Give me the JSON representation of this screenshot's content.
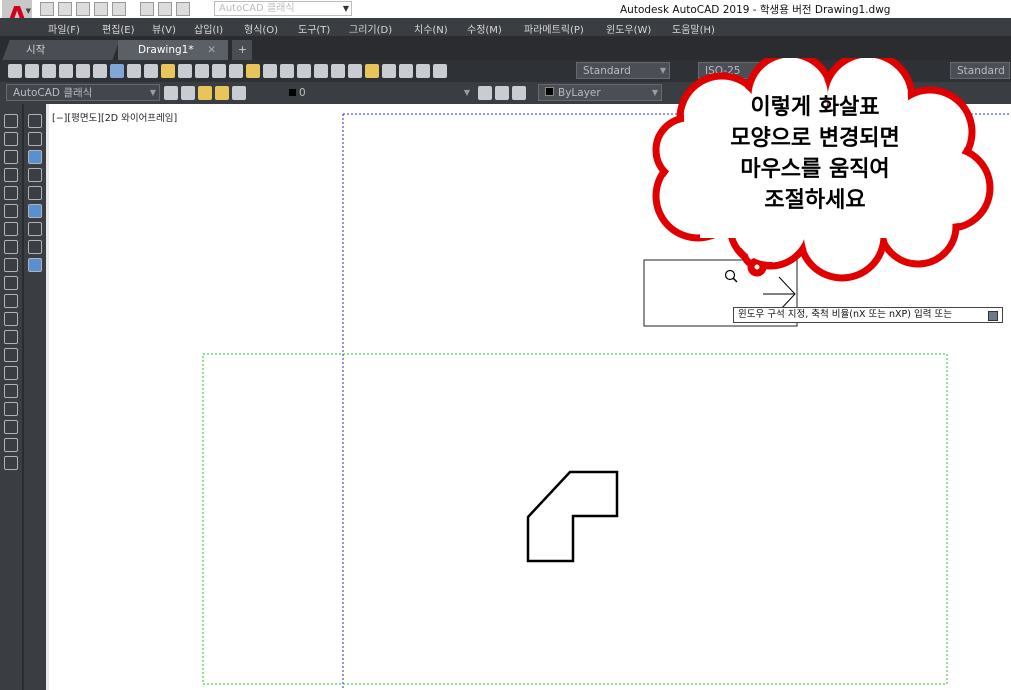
{
  "app": {
    "title": "Autodesk AutoCAD 2019 - 학생용 버전    Drawing1.dwg",
    "logo": "A",
    "workspace": "AutoCAD 클래식"
  },
  "menu": [
    "파일(F)",
    "편집(E)",
    "뷰(V)",
    "삽입(I)",
    "형식(O)",
    "도구(T)",
    "그리기(D)",
    "치수(N)",
    "수정(M)",
    "파라메트릭(P)",
    "윈도우(W)",
    "도움말(H)"
  ],
  "tabs": {
    "start": "시작",
    "drawing": "Drawing1*",
    "close": "✕",
    "add": "+"
  },
  "toolbar": {
    "text_style": "Standard",
    "dim_style": "ISO-25",
    "table_style": "Standard",
    "workspace": "AutoCAD 클래식",
    "layer": "0",
    "color": "ByLayer"
  },
  "viewport_label": "[−][평면도][2D 와이어프레임]",
  "tooltip": "윈도우 구석 지정, 축척 비율(nX 또는 nXP) 입력 또는",
  "callout": {
    "text": "이렇게 화살표\n모양으로 변경되면\n마우스를 움직여\n조절하세요",
    "color": "#e00000"
  },
  "colors": {
    "accent": "#d0021b",
    "limits_dash": "#2a2adf",
    "paper_dash": "#22cc22"
  }
}
